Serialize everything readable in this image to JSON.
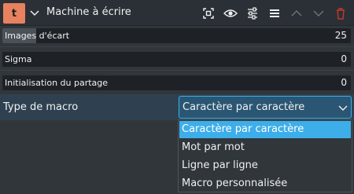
{
  "header": {
    "badge": "t",
    "title": "Machine à écrire",
    "icons": [
      "collapse-chevron-icon",
      "zone-select-icon",
      "visibility-eye-icon",
      "settings-sliders-icon",
      "menu-icon",
      "move-up-icon",
      "move-down-icon",
      "delete-trash-icon"
    ],
    "colors": {
      "badge": "#e8815f",
      "delete": "#c0392b",
      "accent": "#3daee9"
    }
  },
  "params": [
    {
      "label": "Images d'écart",
      "value": "25",
      "fill": 0.1
    },
    {
      "label": "Sigma",
      "value": "0",
      "fill": 0
    },
    {
      "label": "Initialisation du partage",
      "value": "0",
      "fill": 0
    }
  ],
  "macro": {
    "label": "Type de macro",
    "selected": "Caractère par caractère",
    "options": [
      "Caractère par caractère",
      "Mot par mot",
      "Ligne par ligne",
      "Macro personnalisée"
    ]
  }
}
